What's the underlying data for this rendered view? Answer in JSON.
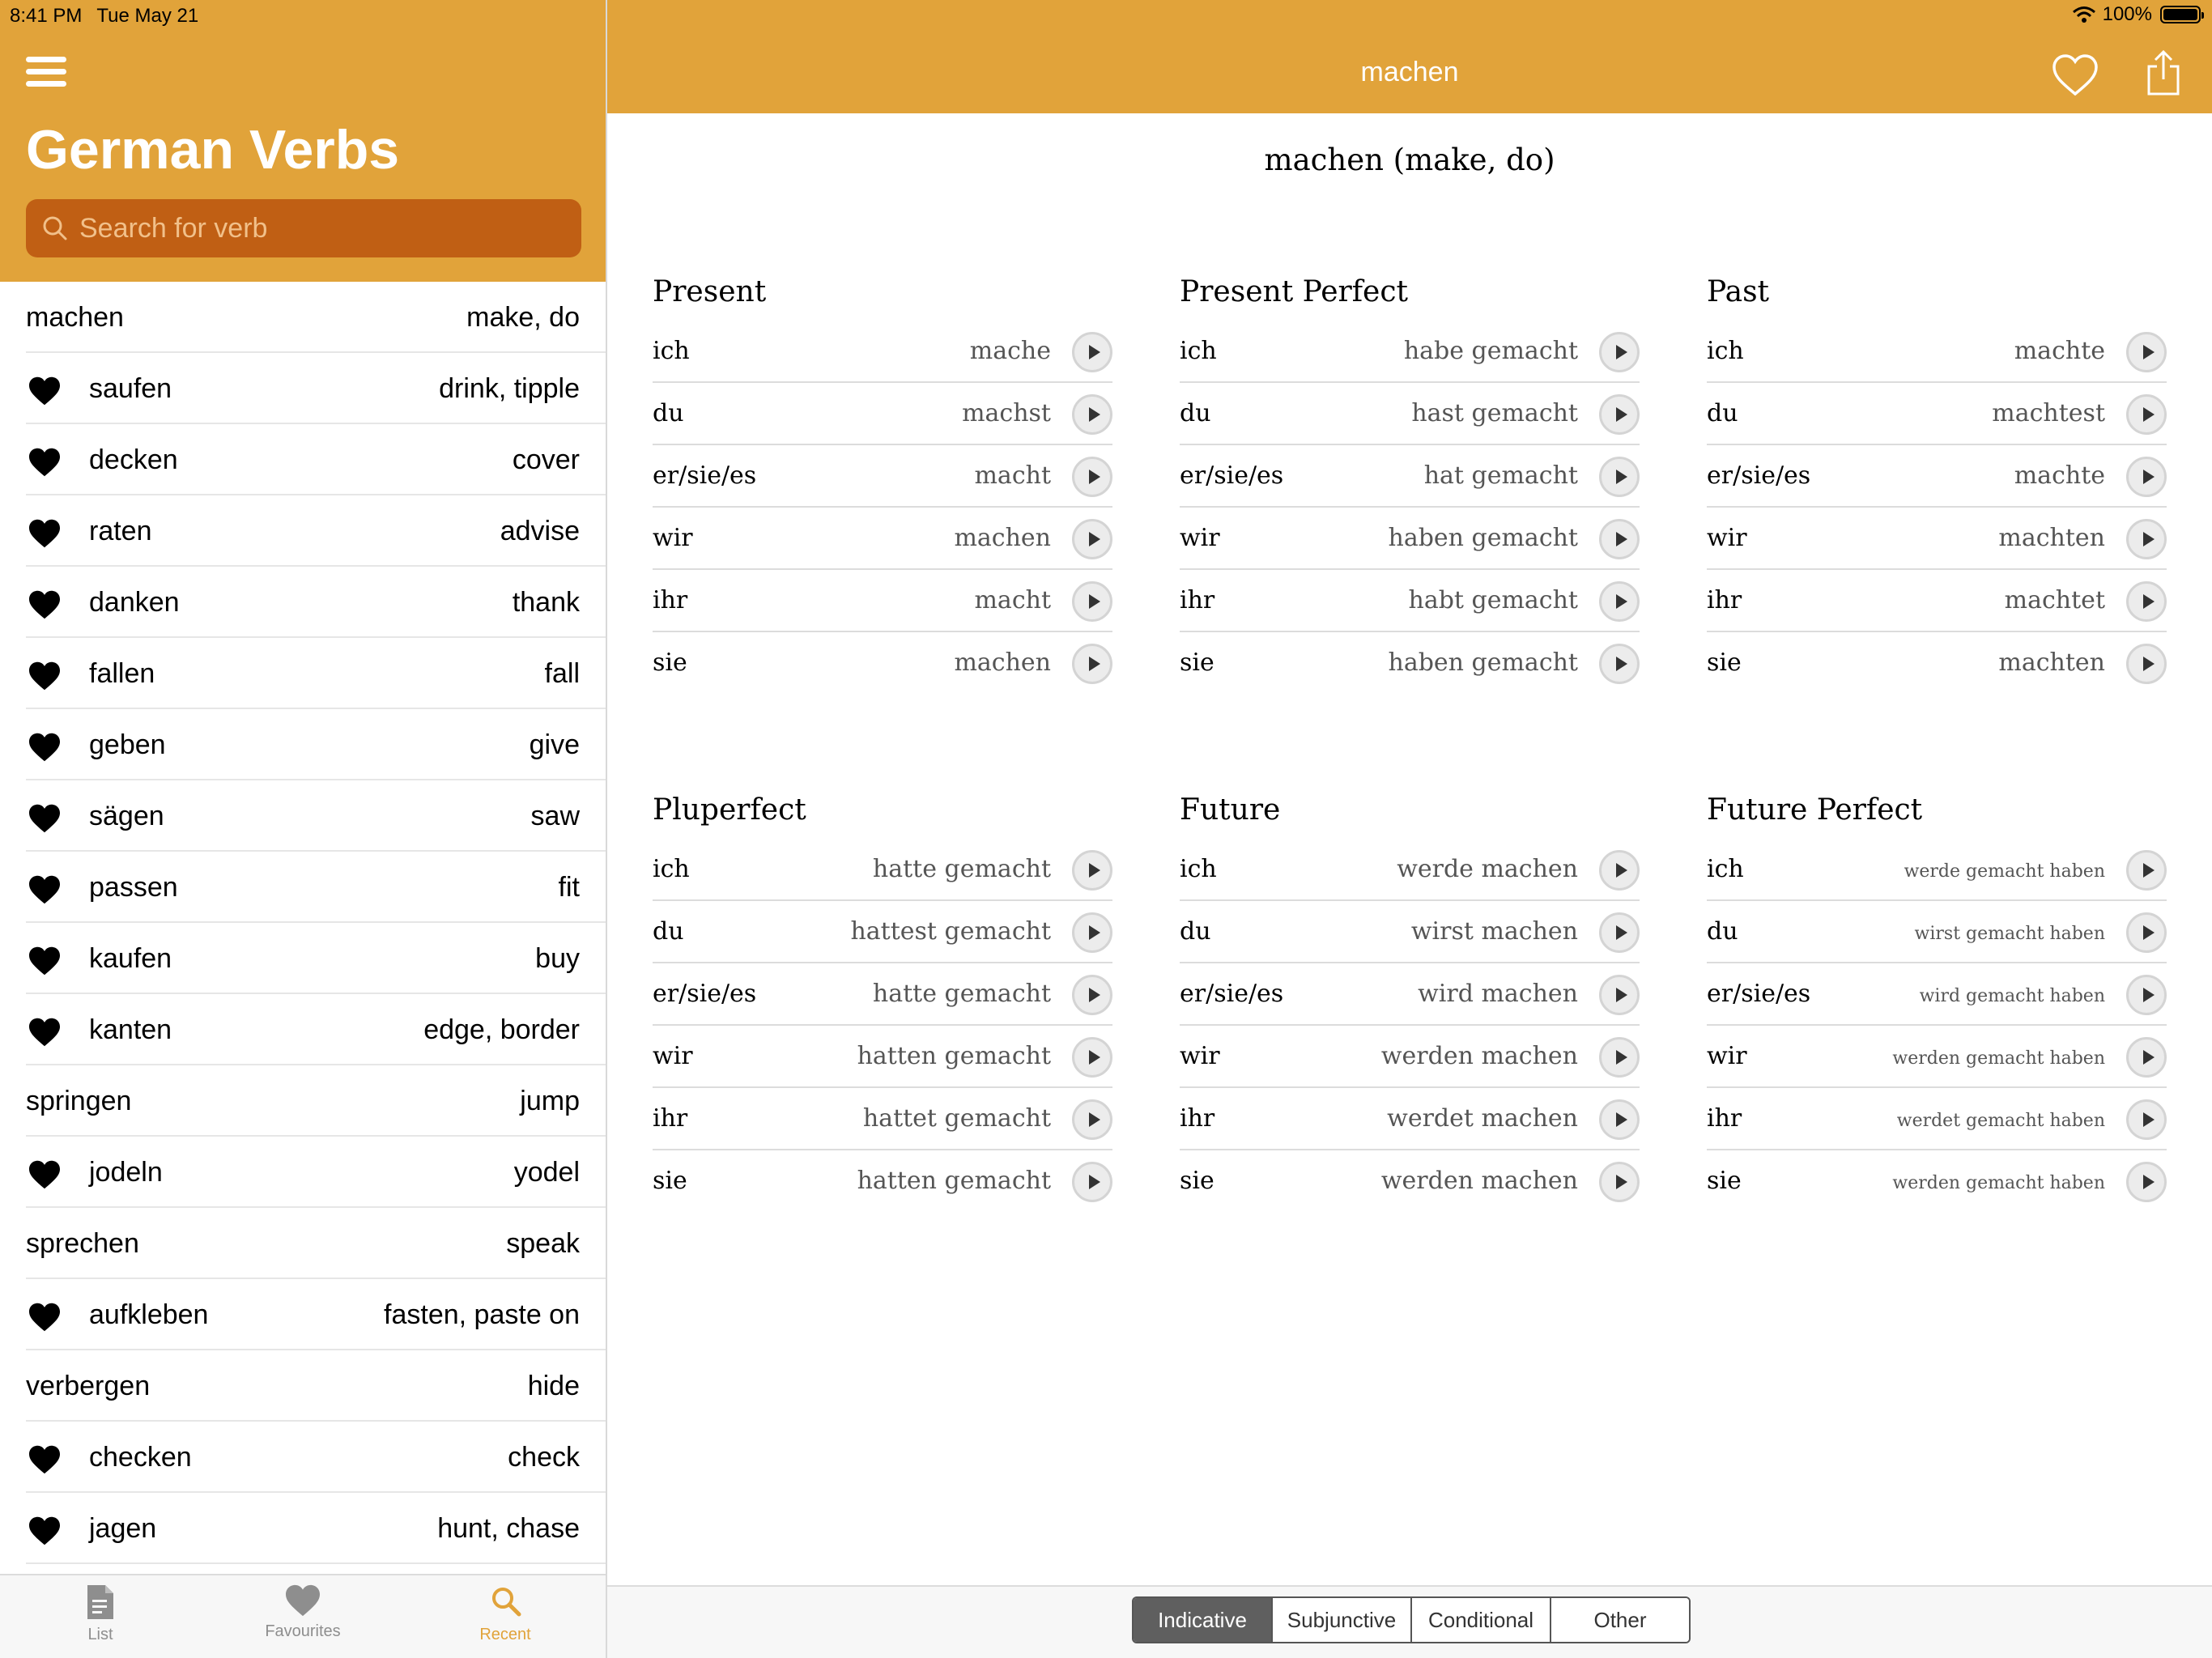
{
  "status_bar": {
    "time": "8:41 PM",
    "date": "Tue May 21",
    "battery": "100%"
  },
  "sidebar": {
    "title": "German Verbs",
    "search_placeholder": "Search for verb",
    "verbs": [
      {
        "verb": "machen",
        "meaning": "make, do",
        "favourite": false
      },
      {
        "verb": "saufen",
        "meaning": "drink, tipple",
        "favourite": true
      },
      {
        "verb": "decken",
        "meaning": "cover",
        "favourite": true
      },
      {
        "verb": "raten",
        "meaning": "advise",
        "favourite": true
      },
      {
        "verb": "danken",
        "meaning": "thank",
        "favourite": true
      },
      {
        "verb": "fallen",
        "meaning": "fall",
        "favourite": true
      },
      {
        "verb": "geben",
        "meaning": "give",
        "favourite": true
      },
      {
        "verb": "sägen",
        "meaning": "saw",
        "favourite": true
      },
      {
        "verb": "passen",
        "meaning": "fit",
        "favourite": true
      },
      {
        "verb": "kaufen",
        "meaning": "buy",
        "favourite": true
      },
      {
        "verb": "kanten",
        "meaning": "edge, border",
        "favourite": true
      },
      {
        "verb": "springen",
        "meaning": "jump",
        "favourite": false
      },
      {
        "verb": "jodeln",
        "meaning": "yodel",
        "favourite": true
      },
      {
        "verb": "sprechen",
        "meaning": "speak",
        "favourite": false
      },
      {
        "verb": "aufkleben",
        "meaning": "fasten, paste on",
        "favourite": true
      },
      {
        "verb": "verbergen",
        "meaning": "hide",
        "favourite": false
      },
      {
        "verb": "checken",
        "meaning": "check",
        "favourite": true
      },
      {
        "verb": "jagen",
        "meaning": "hunt, chase",
        "favourite": true
      }
    ],
    "tabs": [
      {
        "label": "List",
        "icon": "document-icon",
        "active": false
      },
      {
        "label": "Favourites",
        "icon": "heart-icon",
        "active": false
      },
      {
        "label": "Recent",
        "icon": "search-icon",
        "active": true
      }
    ]
  },
  "detail": {
    "nav_title": "machen",
    "heading": "machen (make, do)",
    "tenses": [
      {
        "title": "Present",
        "rows": [
          {
            "pronoun": "ich",
            "form": "mache"
          },
          {
            "pronoun": "du",
            "form": "machst"
          },
          {
            "pronoun": "er/sie/es",
            "form": "macht"
          },
          {
            "pronoun": "wir",
            "form": "machen"
          },
          {
            "pronoun": "ihr",
            "form": "macht"
          },
          {
            "pronoun": "sie",
            "form": "machen"
          }
        ]
      },
      {
        "title": "Present Perfect",
        "rows": [
          {
            "pronoun": "ich",
            "form": "habe gemacht"
          },
          {
            "pronoun": "du",
            "form": "hast gemacht"
          },
          {
            "pronoun": "er/sie/es",
            "form": "hat gemacht"
          },
          {
            "pronoun": "wir",
            "form": "haben gemacht"
          },
          {
            "pronoun": "ihr",
            "form": "habt gemacht"
          },
          {
            "pronoun": "sie",
            "form": "haben gemacht"
          }
        ]
      },
      {
        "title": "Past",
        "rows": [
          {
            "pronoun": "ich",
            "form": "machte"
          },
          {
            "pronoun": "du",
            "form": "machtest"
          },
          {
            "pronoun": "er/sie/es",
            "form": "machte"
          },
          {
            "pronoun": "wir",
            "form": "machten"
          },
          {
            "pronoun": "ihr",
            "form": "machtet"
          },
          {
            "pronoun": "sie",
            "form": "machten"
          }
        ]
      },
      {
        "title": "Pluperfect",
        "rows": [
          {
            "pronoun": "ich",
            "form": "hatte gemacht"
          },
          {
            "pronoun": "du",
            "form": "hattest gemacht"
          },
          {
            "pronoun": "er/sie/es",
            "form": "hatte gemacht"
          },
          {
            "pronoun": "wir",
            "form": "hatten gemacht"
          },
          {
            "pronoun": "ihr",
            "form": "hattet gemacht"
          },
          {
            "pronoun": "sie",
            "form": "hatten gemacht"
          }
        ]
      },
      {
        "title": "Future",
        "rows": [
          {
            "pronoun": "ich",
            "form": "werde machen"
          },
          {
            "pronoun": "du",
            "form": "wirst machen"
          },
          {
            "pronoun": "er/sie/es",
            "form": "wird machen"
          },
          {
            "pronoun": "wir",
            "form": "werden machen"
          },
          {
            "pronoun": "ihr",
            "form": "werdet machen"
          },
          {
            "pronoun": "sie",
            "form": "werden machen"
          }
        ]
      },
      {
        "title": "Future Perfect",
        "rows": [
          {
            "pronoun": "ich",
            "form": "werde gemacht haben"
          },
          {
            "pronoun": "du",
            "form": "wirst gemacht haben"
          },
          {
            "pronoun": "er/sie/es",
            "form": "wird gemacht haben"
          },
          {
            "pronoun": "wir",
            "form": "werden gemacht haben"
          },
          {
            "pronoun": "ihr",
            "form": "werdet gemacht haben"
          },
          {
            "pronoun": "sie",
            "form": "werden gemacht haben"
          }
        ]
      }
    ],
    "moods": [
      {
        "label": "Indicative",
        "selected": true
      },
      {
        "label": "Subjunctive",
        "selected": false
      },
      {
        "label": "Conditional",
        "selected": false
      },
      {
        "label": "Other",
        "selected": false
      }
    ]
  },
  "colors": {
    "accent": "#e1a33a",
    "search_bg": "#c05f14",
    "selected_segment": "#5f5f5f"
  }
}
